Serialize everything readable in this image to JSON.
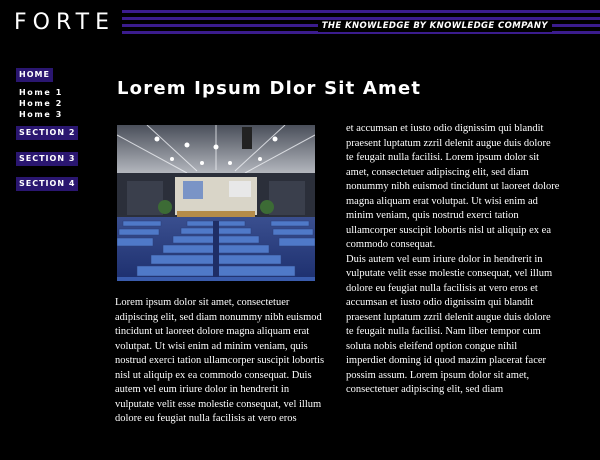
{
  "header": {
    "logo": "FORTE",
    "tagline": "THE KNOWLEDGE BY KNOWLEDGE COMPANY"
  },
  "nav": {
    "home": "HOME",
    "home_items": [
      "Home 1",
      "Home 2",
      "Home 3"
    ],
    "sections": [
      "SECTION 2",
      "SECTION 3",
      "SECTION 4"
    ]
  },
  "main": {
    "title": "Lorem Ipsum Dlor Sit Amet",
    "left_text": "Lorem ipsum dolor sit amet, consectetuer adipiscing elit, sed diam nonummy nibh euismod tincidunt ut laoreet dolore magna aliquam erat volutpat.  Ut wisi enim ad minim veniam, quis nostrud exerci tation ullamcorper suscipit lobortis nisl ut aliquip ex ea commodo consequat.  Duis autem vel eum iriure dolor in hendrerit in vulputate velit esse molestie consequat, vel illum dolore eu feugiat nulla facilisis at vero eros",
    "right_text_1": "et accumsan et iusto odio dignissim qui blandit praesent luptatum zzril delenit augue duis dolore te feugait nulla facilisi. Lorem ipsum dolor sit amet, consectetuer adipiscing elit, sed diam nonummy nibh euismod tincidunt ut laoreet dolore magna aliquam erat volutpat.  Ut wisi enim ad minim veniam, quis nostrud exerci tation ullamcorper suscipit lobortis nisl ut aliquip ex ea commodo consequat.",
    "right_text_2": "Duis autem vel eum iriure dolor in hendrerit in vulputate velit esse molestie consequat, vel illum dolore eu feugiat nulla facilisis at vero eros et accumsan et iusto odio dignissim qui blandit praesent luptatum zzril delenit augue duis dolore te feugait nulla facilisi. Nam liber tempor cum soluta nobis eleifend option congue nihil imperdiet doming id quod mazim placerat facer possim assum.  Lorem ipsum dolor sit amet, consectetuer adipiscing elit, sed diam"
  },
  "colors": {
    "background": "#000000",
    "accent_purple": "#3b1c8e",
    "nav_button": "#2a1670",
    "text": "#ffffff"
  }
}
